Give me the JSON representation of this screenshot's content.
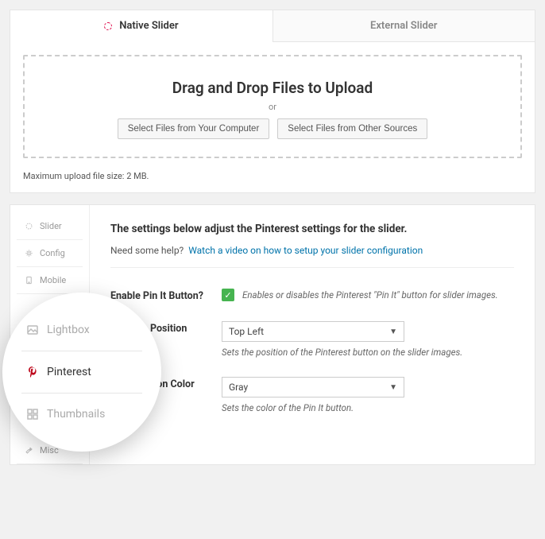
{
  "tabs": {
    "native": "Native Slider",
    "external": "External Slider"
  },
  "dropzone": {
    "headline": "Drag and Drop Files to Upload",
    "or": "or",
    "btn_computer": "Select Files from Your Computer",
    "btn_other": "Select Files from Other Sources"
  },
  "maxsize": "Maximum upload file size: 2 MB.",
  "sidebar": {
    "slider": "Slider",
    "config": "Config",
    "mobile": "Mobile",
    "lightbox": "Lightbox",
    "pinterest": "Pinterest",
    "thumbnails": "Thumbnails",
    "misc": "Misc"
  },
  "content": {
    "heading": "The settings below adjust the Pinterest settings for the slider.",
    "help_prefix": "Need some help?",
    "help_link": "Watch a video on how to setup your slider configuration",
    "enable_label": "Enable Pin It Button?",
    "enable_desc": "Enables or disables the Pinterest \"Pin It\" button for slider images.",
    "position_label": "Position",
    "position_value": "Top Left",
    "position_desc": "Sets the position of the Pinterest button on the slider images.",
    "color_label": "tton Color",
    "color_value": "Gray",
    "color_desc": "Sets the color of the Pin It button."
  }
}
